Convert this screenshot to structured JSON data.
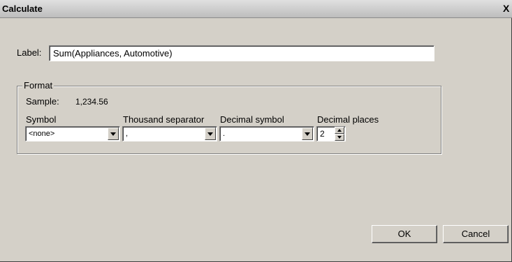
{
  "window": {
    "title": "Calculate",
    "close_glyph": "X"
  },
  "label_field": {
    "label": "Label:",
    "value": "Sum(Appliances, Automotive)"
  },
  "format": {
    "legend": "Format",
    "sample_label": "Sample:",
    "sample_value": "1,234.56",
    "symbol": {
      "label": "Symbol",
      "value": "<none>"
    },
    "thousand_separator": {
      "label": "Thousand separator",
      "value": ","
    },
    "decimal_symbol": {
      "label": "Decimal symbol",
      "value": "."
    },
    "decimal_places": {
      "label": "Decimal places",
      "value": "2"
    }
  },
  "buttons": {
    "ok": "OK",
    "cancel": "Cancel"
  },
  "icons": {
    "dropdown": "chevron-down-icon",
    "spin_up": "arrow-up-icon",
    "spin_down": "arrow-down-icon",
    "close": "close-icon"
  }
}
